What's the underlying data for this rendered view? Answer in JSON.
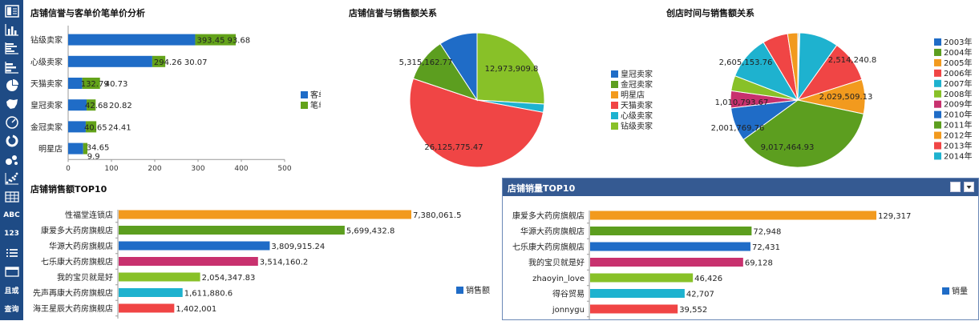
{
  "sidebar": {
    "items": [
      {
        "name": "dashboard-icon",
        "text": ""
      },
      {
        "name": "column-chart-icon",
        "text": ""
      },
      {
        "name": "bar-chart-icon",
        "text": ""
      },
      {
        "name": "stacked-bar-icon",
        "text": ""
      },
      {
        "name": "pie-chart-icon",
        "text": ""
      },
      {
        "name": "map-icon",
        "text": ""
      },
      {
        "name": "gauge-icon",
        "text": ""
      },
      {
        "name": "ring-chart-icon",
        "text": ""
      },
      {
        "name": "bubble-chart-icon",
        "text": ""
      },
      {
        "name": "scatter-chart-icon",
        "text": ""
      },
      {
        "name": "table-icon",
        "text": ""
      },
      {
        "name": "text-widget",
        "text": "ABC"
      },
      {
        "name": "number-widget",
        "text": "123"
      },
      {
        "name": "list-icon",
        "text": ""
      },
      {
        "name": "calendar-icon",
        "text": ""
      },
      {
        "name": "filter-widget",
        "text": "且或"
      },
      {
        "name": "query-widget",
        "text": "查询"
      }
    ]
  },
  "chart_data": [
    {
      "id": "credit-price",
      "type": "bar",
      "title": "店铺信誉与客单价笔单价分析",
      "categories": [
        "钻级卖家",
        "心级卖家",
        "天猫卖家",
        "皇冠卖家",
        "金冠卖家",
        "明星店"
      ],
      "series": [
        {
          "name": "客单价",
          "values": [
            293.45,
            194.26,
            32.79,
            42.68,
            40.65,
            34.65
          ],
          "color": "#1f6cc7"
        },
        {
          "name": "笔单价",
          "values": [
            93.68,
            30.07,
            40.73,
            20.82,
            24.41,
            9.9
          ],
          "color": "#63a31a"
        }
      ],
      "labels": [
        [
          "393.45",
          "93.68"
        ],
        [
          "294.26",
          "30.07"
        ],
        [
          "132.79",
          "40.73"
        ],
        [
          "42.68",
          "20.82"
        ],
        [
          "40.65",
          "24.41"
        ],
        [
          "34.65",
          "9.9"
        ]
      ],
      "xticks": [
        0,
        100,
        200,
        300,
        400,
        500
      ],
      "xlim": [
        0,
        500
      ]
    },
    {
      "id": "credit-sales",
      "type": "pie",
      "title": "店铺信誉与销售额关系",
      "slices": [
        {
          "name": "钻级卖家",
          "value": 12973909.8,
          "label": "12,973,909.8",
          "color": "#88c128"
        },
        {
          "name": "心级卖家",
          "value": 1000000,
          "label": "",
          "color": "#1eb2cf"
        },
        {
          "name": "天猫卖家",
          "value": 26125775.47,
          "label": "26,125,775.47",
          "color": "#f04545"
        },
        {
          "name": "金冠卖家",
          "value": 5315162.77,
          "label": "5,315,162.77",
          "color": "#5c9e1f"
        },
        {
          "name": "皇冠卖家",
          "value": 4600000,
          "label": "",
          "color": "#1f6cc7"
        },
        {
          "name": "明星店",
          "value": 0,
          "label": "",
          "color": "#f29a1e"
        }
      ],
      "legend": [
        {
          "name": "皇冠卖家",
          "color": "#1f6cc7"
        },
        {
          "name": "金冠卖家",
          "color": "#5c9e1f"
        },
        {
          "name": "明星店",
          "color": "#f29a1e"
        },
        {
          "name": "天猫卖家",
          "color": "#f04545"
        },
        {
          "name": "心级卖家",
          "color": "#1eb2cf"
        },
        {
          "name": "钻级卖家",
          "color": "#88c128"
        }
      ]
    },
    {
      "id": "year-sales",
      "type": "pie",
      "title": "创店时间与销售额关系",
      "slices": [
        {
          "name": "2003年",
          "value": 60000,
          "label": "",
          "color": "#1f6cc7"
        },
        {
          "name": "2004年",
          "value": 60000,
          "label": "",
          "color": "#5c9e1f"
        },
        {
          "name": "2014年",
          "value": 2300000,
          "label": "",
          "color": "#1eb2cf"
        },
        {
          "name": "2013年",
          "value": 2514240.8,
          "label": "2,514,240.8",
          "color": "#f04545"
        },
        {
          "name": "2012年",
          "value": 2029509.13,
          "label": "2,029,509.13",
          "color": "#f29a1e"
        },
        {
          "name": "2011年",
          "value": 9017464.93,
          "label": "9,017,464.93",
          "color": "#5c9e1f"
        },
        {
          "name": "2010年",
          "value": 2001769.76,
          "label": "2,001,769.76",
          "color": "#1f6cc7"
        },
        {
          "name": "2009年",
          "value": 1010793.67,
          "label": "1,010,793.67",
          "color": "#c8316e"
        },
        {
          "name": "2008年",
          "value": 900000,
          "label": "",
          "color": "#88c128"
        },
        {
          "name": "2007年",
          "value": 2605153.76,
          "label": "2,605,153.76",
          "color": "#1eb2cf"
        },
        {
          "name": "2006年",
          "value": 1500000,
          "label": "",
          "color": "#f04545"
        },
        {
          "name": "2005年",
          "value": 600000,
          "label": "",
          "color": "#f29a1e"
        }
      ],
      "legend": [
        {
          "name": "2003年",
          "color": "#1f6cc7"
        },
        {
          "name": "2004年",
          "color": "#5c9e1f"
        },
        {
          "name": "2005年",
          "color": "#f29a1e"
        },
        {
          "name": "2006年",
          "color": "#f04545"
        },
        {
          "name": "2007年",
          "color": "#1eb2cf"
        },
        {
          "name": "2008年",
          "color": "#88c128"
        },
        {
          "name": "2009年",
          "color": "#c8316e"
        },
        {
          "name": "2010年",
          "color": "#1f6cc7"
        },
        {
          "name": "2011年",
          "color": "#5c9e1f"
        },
        {
          "name": "2012年",
          "color": "#f29a1e"
        },
        {
          "name": "2013年",
          "color": "#f04545"
        },
        {
          "name": "2014年",
          "color": "#1eb2cf"
        }
      ]
    },
    {
      "id": "top10-sales",
      "type": "bar",
      "title": "店铺销售额TOP10",
      "series_name": "销售额",
      "categories": [
        "性福堂连锁店",
        "康爱多大药房旗舰店",
        "华源大药房旗舰店",
        "七乐康大药房旗舰店",
        "我的宝贝就是好",
        "先声再康大药房旗舰店",
        "海王星辰大药房旗舰店"
      ],
      "values": [
        7380061.5,
        5699432.8,
        3809915.24,
        3514160.2,
        2054347.83,
        1611880.6,
        1402001
      ],
      "labels": [
        "7,380,061.5",
        "5,699,432.8",
        "3,809,915.24",
        "3,514,160.2",
        "2,054,347.83",
        "1,611,880.6",
        "1,402,001"
      ],
      "colors": [
        "#f29a1e",
        "#5c9e1f",
        "#1f6cc7",
        "#c8316e",
        "#88c128",
        "#1eb2cf",
        "#f04545"
      ],
      "legend_color": "#1f6cc7",
      "xmax": 7380061.5
    },
    {
      "id": "top10-qty",
      "type": "bar",
      "title": "店铺销量TOP10",
      "series_name": "销量",
      "categories": [
        "康爱多大药房旗舰店",
        "华源大药房旗舰店",
        "七乐康大药房旗舰店",
        "我的宝贝就是好",
        "zhaoyin_love",
        "得谷贸易",
        "jonnygu"
      ],
      "values": [
        129317,
        72948,
        72431,
        69128,
        46426,
        42707,
        39552
      ],
      "labels": [
        "129,317",
        "72,948",
        "72,431",
        "69,128",
        "46,426",
        "42,707",
        "39,552"
      ],
      "colors": [
        "#f29a1e",
        "#5c9e1f",
        "#1f6cc7",
        "#c8316e",
        "#88c128",
        "#1eb2cf",
        "#f04545"
      ],
      "legend_color": "#1f6cc7",
      "xmax": 129317
    }
  ]
}
